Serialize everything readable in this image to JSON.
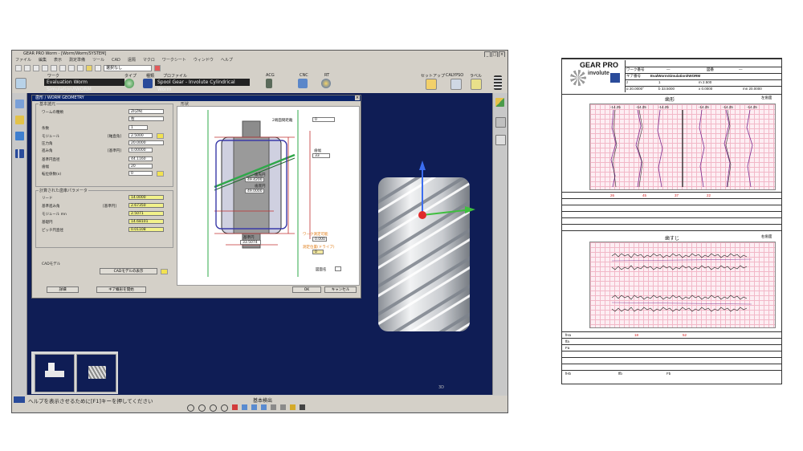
{
  "app": {
    "window_title": "GEAR PRO Worm - [Worm/Worm/SYSTEM]",
    "menu_items": [
      "ファイル",
      "編集",
      "表示",
      "測定準備",
      "ツール",
      "CAD",
      "遠隔",
      "マクロ",
      "ワークシート",
      "ウィンドウ",
      "ヘルプ"
    ],
    "toolbar_combo": "選択なし",
    "toolbar_labels": {
      "work": "ワーク",
      "type": "タイプ",
      "kind": "種類",
      "profile": "プロファイル",
      "acg": "ACG",
      "cnc": "CNC",
      "rt": "RT",
      "setup": "セットアップ",
      "calypso": "CALYPSO",
      "result": "ラベル"
    },
    "work_field": "Evaluation Worm Simulation/IWORM",
    "profile_field": "Spool Gear - Involute Cylindrical Worm",
    "status_help": "ヘルプを表示させるために[F1]キーを押してください",
    "status_mode": "基本検出",
    "axis_label": "3D"
  },
  "dialog": {
    "title": "歯形 / WORM GEOMETRY",
    "group_basic": "基本諸元",
    "group_sketch": "形状",
    "fields": [
      {
        "label": "ワームの種類",
        "value": "ZI(ZN)",
        "sub": ""
      },
      {
        "label": "",
        "value": "右",
        "sub": ""
      },
      {
        "label": "条数",
        "value": "1",
        "sub": ""
      },
      {
        "label": "モジュール",
        "value": "2.5000",
        "sub": "[軸直角]"
      },
      {
        "label": "圧力角",
        "value": "20.0000",
        "sub": ""
      },
      {
        "label": "進み角",
        "value": "0.00000",
        "sub": "[基準円]"
      },
      {
        "label": "基準円直径",
        "value": "44.1160",
        "sub": ""
      },
      {
        "label": "歯幅",
        "value": "20",
        "sub": ""
      },
      {
        "label": "転位係数(x)",
        "value": "0",
        "sub": ""
      }
    ],
    "group_calc": "計算された歯車パラメータ",
    "calc_fields": [
      {
        "label": "リード",
        "value": "14.0000",
        "sub": ""
      },
      {
        "label": "基準進み角",
        "value": "2.67350",
        "sub": "[基準円]"
      },
      {
        "label": "モジュール mn",
        "value": "2.5071",
        "sub": ""
      },
      {
        "label": "基礎円",
        "value": "14.68101",
        "sub": ""
      },
      {
        "label": "ピッチ円直径",
        "value": "0.01108",
        "sub": ""
      }
    ],
    "cad_label": "CADモデル",
    "cad_button": "CADモデルの表示",
    "btn_left1": "詳細",
    "btn_left2": "ギア概形を開始",
    "btn_ok": "OK",
    "btn_cancel": "キャンセル",
    "sketch_labels": {
      "top_right": "2端面間距離",
      "top_right_val": "0",
      "mid_right": "歯幅",
      "mid_right_val": "33",
      "tip": "歯先円",
      "tip_val": "49.4200",
      "root": "歯底円",
      "root_val": "49.0000",
      "pitch_label": "基準円",
      "pitch_val": "33.5074",
      "shaft_orange1": "ワーク測定可能",
      "shaft_val1": "0.000",
      "shaft_orange2": "測定位置(ドライブ)",
      "shaft_val2": "0",
      "check_label": "図面名"
    }
  },
  "report": {
    "brand": "GEAR PRO",
    "brand_sub": "involute",
    "header_rows": [
      [
        "ワーク番号",
        "—",
        "図番",
        "—"
      ],
      [
        "ギア番号",
        "EvalWormSimulation/IWORM",
        "—",
        "—"
      ],
      [
        "z",
        "1",
        "m  2.500",
        "β  21.5882°"
      ],
      [
        "α  20.0000°",
        "b  33.5000",
        "x  0.0000",
        "mn  20.0000"
      ]
    ],
    "section1_title": "歯形",
    "section1_right": "左歯面",
    "section2_title": "歯すじ",
    "section2_right": "右歯面",
    "small_vals": [
      "-14.25",
      "-14.25",
      "-14.25",
      "-14.25",
      "-14.25",
      "-14.25"
    ],
    "footer_vals": [
      "fHa",
      "ffa",
      "Fa",
      "fHb",
      "ffb",
      "Fb"
    ],
    "red_vals": [
      "26",
      "45",
      "37",
      "22",
      "18",
      "52"
    ]
  },
  "colors": {
    "canvas": "#0f1d55",
    "dialog_title": "#0a246a",
    "highlight_field": "#f2f28a",
    "report_curve": "#7b2b8f"
  }
}
